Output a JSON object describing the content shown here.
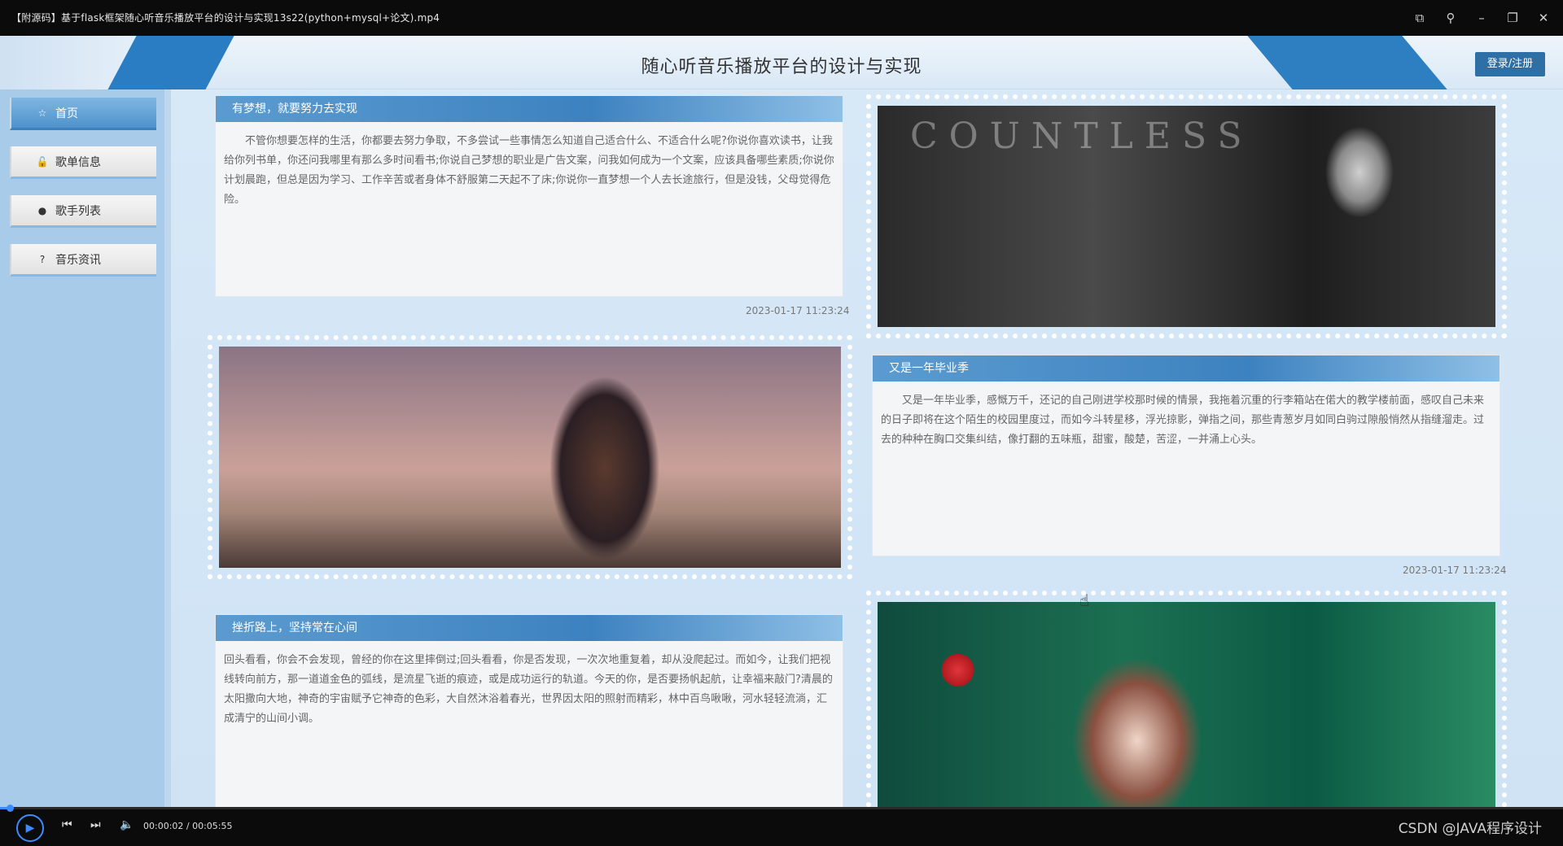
{
  "player": {
    "title": "【附源码】基于flask框架随心听音乐播放平台的设计与实现13s22(python+mysql+论文).mp4",
    "time": "00:00:02 / 00:05:55",
    "watermark": "CSDN @JAVA程序设计",
    "progress_fraction": 0.006,
    "icons": [
      "picture-in-picture-icon",
      "pin-icon",
      "minimize-icon",
      "restore-icon",
      "close-icon",
      "play-icon",
      "previous-icon",
      "next-icon",
      "volume-icon"
    ]
  },
  "site": {
    "title": "随心听音乐播放平台的设计与实现",
    "login_label": "登录/注册"
  },
  "nav": [
    {
      "label": "首页",
      "icon": "star-icon"
    },
    {
      "label": "歌单信息",
      "icon": "lock-icon"
    },
    {
      "label": "歌手列表",
      "icon": "info-icon"
    },
    {
      "label": "音乐资讯",
      "icon": "question-icon"
    }
  ],
  "articles": [
    {
      "title": "有梦想，就要努力去实现",
      "body": "不管你想要怎样的生活，你都要去努力争取，不多尝试一些事情怎么知道自己适合什么、不适合什么呢?你说你喜欢读书，让我给你列书单，你还问我哪里有那么多时间看书;你说自己梦想的职业是广告文案，问我如何成为一个文案，应该具备哪些素质;你说你计划晨跑，但总是因为学习、工作辛苦或者身体不舒服第二天起不了床;你说你一直梦想一个人去长途旅行，但是没钱，父母觉得危险。",
      "date": "2023-01-17 11:23:24"
    },
    {
      "title": "又是一年毕业季",
      "body": "又是一年毕业季，感慨万千，还记的自己刚进学校那时候的情景，我拖着沉重的行李箱站在偌大的教学楼前面，感叹自己未来的日子即将在这个陌生的校园里度过，而如今斗转星移，浮光掠影，弹指之间，那些青葱岁月如同白驹过隙般悄然从指缝溜走。过去的种种在胸口交集纠结，像打翻的五味瓶，甜蜜，酸楚，苦涩，一并涌上心头。",
      "date": "2023-01-17 11:23:24"
    },
    {
      "title": "挫折路上，坚持常在心间",
      "body": "回头看看，你会不会发现，曾经的你在这里摔倒过;回头看看，你是否发现，一次次地重复着，却从没爬起过。而如今，让我们把视线转向前方，那一道道金色的弧线，是流星飞逝的痕迹，或是成功运行的轨道。今天的你，是否要扬帆起航，让幸福来敲门?清晨的太阳撒向大地，神奇的宇宙赋予它神奇的色彩，大自然沐浴着春光，世界因太阳的照射而精彩，林中百鸟啾啾，河水轻轻流淌，汇成清宁的山间小调。"
    }
  ],
  "images": [
    {
      "overlay_text": "COUNTLESS"
    }
  ]
}
